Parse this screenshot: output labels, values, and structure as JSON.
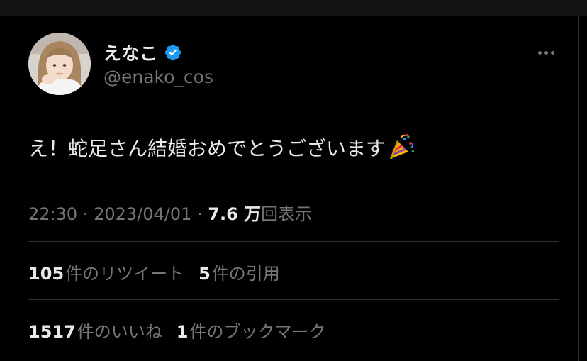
{
  "tweet": {
    "author": {
      "display_name": "えなこ",
      "handle": "@enako_cos",
      "verified": true,
      "verified_color": "#1d9bf0",
      "avatar_icon": "profile-photo"
    },
    "text": "え！蛇足さん結婚おめでとうございます",
    "emoji": "party-popper",
    "meta": {
      "time": "22:30",
      "separator": " · ",
      "date": "2023/04/01",
      "views_count": "7.6 万",
      "views_label": "回表示"
    },
    "stats": {
      "retweets": {
        "count": "105",
        "label": "件のリツイート"
      },
      "quotes": {
        "count": "5",
        "label": "件の引用"
      },
      "likes": {
        "count": "1517",
        "label": "件のいいね"
      },
      "bookmarks": {
        "count": "1",
        "label": "件のブックマーク"
      }
    },
    "more_icon": "more-horizontal-icon"
  },
  "colors": {
    "background": "#000000",
    "primary_text": "#e7e9ea",
    "secondary_text": "#71767b",
    "divider": "#2f3336"
  }
}
